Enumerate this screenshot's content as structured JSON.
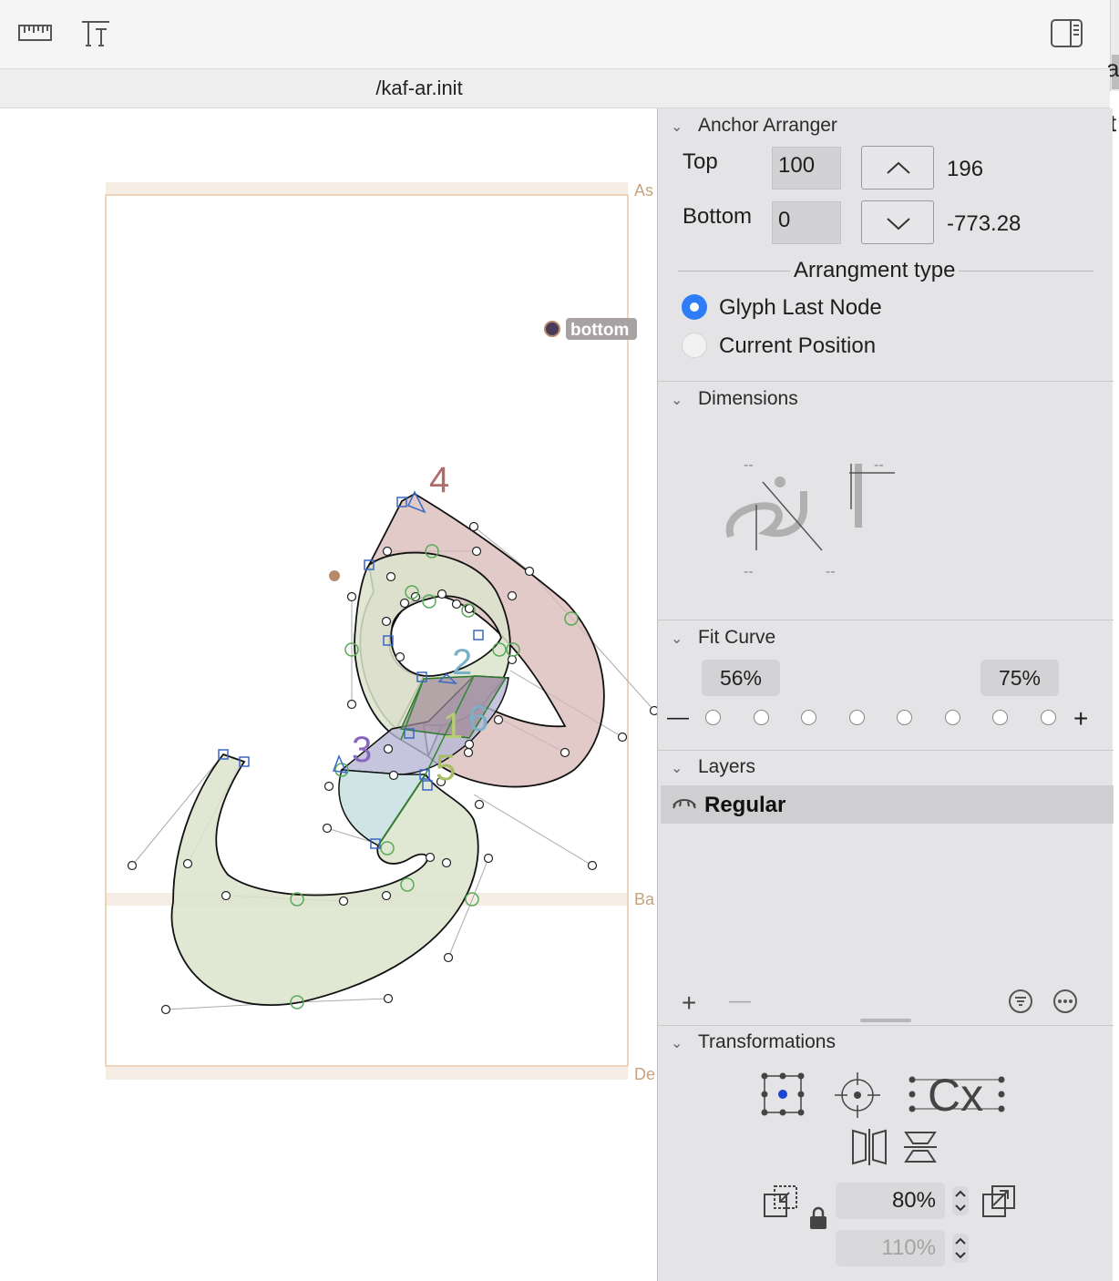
{
  "toolbar": {
    "icons": [
      "ruler-icon",
      "text-metrics-icon",
      "sidebar-toggle-icon"
    ]
  },
  "side_strip": {
    "top_char": "a",
    "mid_char": "t"
  },
  "tab": {
    "title": "/kaf-ar.init"
  },
  "canvas": {
    "metric_labels": {
      "ascender": "As",
      "baseline": "Ba",
      "descender": "De"
    },
    "anchor_label": "bottom",
    "node_numbers": [
      "4",
      "2",
      "1",
      "6",
      "3",
      "5"
    ]
  },
  "panel": {
    "anchor_arranger": {
      "title": "Anchor Arranger",
      "top_label": "Top",
      "top_value": "100",
      "top_result": "196",
      "bottom_label": "Bottom",
      "bottom_value": "0",
      "bottom_result": "-773.28",
      "arrangement_title": "Arrangment type",
      "options": [
        {
          "label": "Glyph Last Node",
          "selected": true
        },
        {
          "label": "Current Position",
          "selected": false
        }
      ]
    },
    "dimensions": {
      "title": "Dimensions",
      "placeholders": [
        "--",
        "--",
        "--",
        "--"
      ]
    },
    "fit_curve": {
      "title": "Fit Curve",
      "left_value": "56%",
      "right_value": "75%",
      "minus": "—",
      "plus": "+",
      "dot_count": 8
    },
    "layers": {
      "title": "Layers",
      "items": [
        {
          "name": "Regular",
          "visible": true
        }
      ],
      "add": "+",
      "remove": "—"
    },
    "transformations": {
      "title": "Transformations",
      "scale_value": "80%",
      "scale_value_2": "110%",
      "font_demo": "Cx"
    }
  },
  "colors": {
    "accent": "#2f7df6",
    "panel_bg": "#e4e3e6",
    "metric_line": "#e8c9a9",
    "label_tan": "#c8a27c"
  }
}
